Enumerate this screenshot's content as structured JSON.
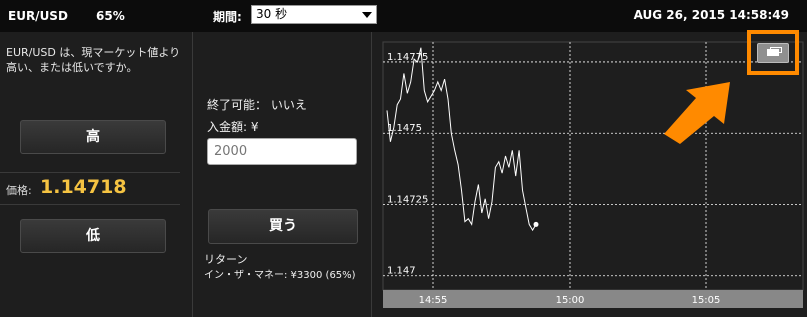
{
  "header": {
    "pair": "EUR/USD",
    "payout": "65%",
    "period_label": "期間:",
    "period_value": "30 秒",
    "datetime": "AUG 26, 2015 14:58:49"
  },
  "left": {
    "question": "EUR/USD は、現マーケット値より高い、または低いですか。",
    "high_label": "高",
    "price_label": "価格:",
    "price_value": "1.14718",
    "low_label": "低"
  },
  "middle": {
    "expire": "終了可能： いいえ",
    "deposit_label": "入金額: ¥",
    "amount_placeholder": "2000",
    "buy_label": "買う",
    "return_label": "リターン",
    "return_value": "イン・ザ・マネー: ¥3300 (65%)"
  },
  "colors": {
    "price": "#f5c342",
    "accent": "#ff8a00",
    "background": "#1e1e1e",
    "header": "#0c0c0c"
  },
  "chart_data": {
    "type": "line",
    "y_ticks": [
      "1.14775",
      "1.1475",
      "1.14725",
      "1.147"
    ],
    "y_values": [
      1.14775,
      1.1475,
      1.14725,
      1.147
    ],
    "x_ticks": [
      "14:55",
      "15:00",
      "15:05"
    ],
    "ylim": [
      1.14695,
      1.14782
    ],
    "grid": true,
    "series": [
      {
        "values": [
          1.14758,
          1.14747,
          1.14752,
          1.1476,
          1.14762,
          1.14771,
          1.14764,
          1.14768,
          1.14776,
          1.14775,
          1.1478,
          1.14765,
          1.14761,
          1.14763,
          1.14765,
          1.14768,
          1.14765,
          1.14769,
          1.14762,
          1.1475,
          1.14744,
          1.14739,
          1.1473,
          1.14719,
          1.1472,
          1.14718,
          1.14726,
          1.14732,
          1.14722,
          1.14727,
          1.1472,
          1.14726,
          1.14738,
          1.1474,
          1.14736,
          1.14742,
          1.14738,
          1.14744,
          1.14735,
          1.14744,
          1.1473,
          1.14724,
          1.14718,
          1.14716,
          1.14718
        ]
      }
    ]
  },
  "icons": {
    "expand": "expand-chart-icon",
    "arrow": "annotation-arrow-icon"
  }
}
